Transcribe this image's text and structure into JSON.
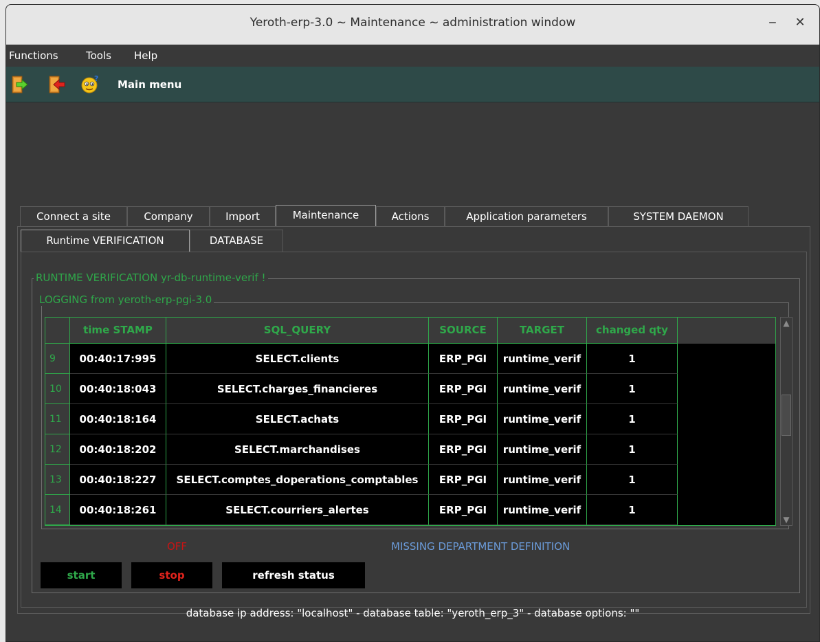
{
  "window": {
    "title": "Yeroth-erp-3.0 ~ Maintenance ~ administration window",
    "minimize_glyph": "‒",
    "close_glyph": "✕"
  },
  "menubar": {
    "items": [
      "Functions",
      "Tools",
      "Help"
    ]
  },
  "toolbar": {
    "icons": [
      "door-enter-icon",
      "door-exit-icon",
      "help-smiley-icon"
    ],
    "main_menu_label": "Main menu"
  },
  "tabs": [
    {
      "label": "Connect a site",
      "active": false
    },
    {
      "label": "Company",
      "active": false
    },
    {
      "label": "Import",
      "active": false
    },
    {
      "label": "Maintenance",
      "active": true
    },
    {
      "label": "Actions",
      "active": false
    },
    {
      "label": "Application parameters",
      "active": false
    },
    {
      "label": "SYSTEM DAEMON",
      "active": false
    }
  ],
  "subtabs": [
    {
      "label": "Runtime VERIFICATION",
      "active": true
    },
    {
      "label": "DATABASE",
      "active": false
    }
  ],
  "runtime_group": {
    "title": "RUNTIME VERIFICATION yr-db-runtime-verif !",
    "logging_title": "LOGGING from yeroth-erp-pgi-3.0"
  },
  "log_table": {
    "columns": [
      "time STAMP",
      "SQL_QUERY",
      "SOURCE",
      "TARGET",
      "changed qty"
    ],
    "rows": [
      {
        "num": "9",
        "time": "00:40:17:995",
        "query": "SELECT.clients",
        "source": "ERP_PGI",
        "target": "runtime_verif",
        "qty": "1"
      },
      {
        "num": "10",
        "time": "00:40:18:043",
        "query": "SELECT.charges_financieres",
        "source": "ERP_PGI",
        "target": "runtime_verif",
        "qty": "1"
      },
      {
        "num": "11",
        "time": "00:40:18:164",
        "query": "SELECT.achats",
        "source": "ERP_PGI",
        "target": "runtime_verif",
        "qty": "1"
      },
      {
        "num": "12",
        "time": "00:40:18:202",
        "query": "SELECT.marchandises",
        "source": "ERP_PGI",
        "target": "runtime_verif",
        "qty": "1"
      },
      {
        "num": "13",
        "time": "00:40:18:227",
        "query": "SELECT.comptes_doperations_comptables",
        "source": "ERP_PGI",
        "target": "runtime_verif",
        "qty": "1"
      },
      {
        "num": "14",
        "time": "00:40:18:261",
        "query": "SELECT.courriers_alertes",
        "source": "ERP_PGI",
        "target": "runtime_verif",
        "qty": "1"
      }
    ],
    "scrollbar": {
      "up_glyph": "▲",
      "down_glyph": "▼"
    }
  },
  "status": {
    "state": "OFF",
    "department_message": "MISSING DEPARTMENT DEFINITION"
  },
  "buttons": {
    "start": "start",
    "stop": "stop",
    "refresh": "refresh status"
  },
  "footer": {
    "connection_info": "database ip address: \"localhost\" - database table: \"yeroth_erp_3\" - database options: \"\""
  },
  "colors": {
    "accent_green": "#2fa84a",
    "stop_red": "#c81414",
    "info_blue": "#6b9bd9",
    "toolbar_bg": "#2e4a48"
  }
}
